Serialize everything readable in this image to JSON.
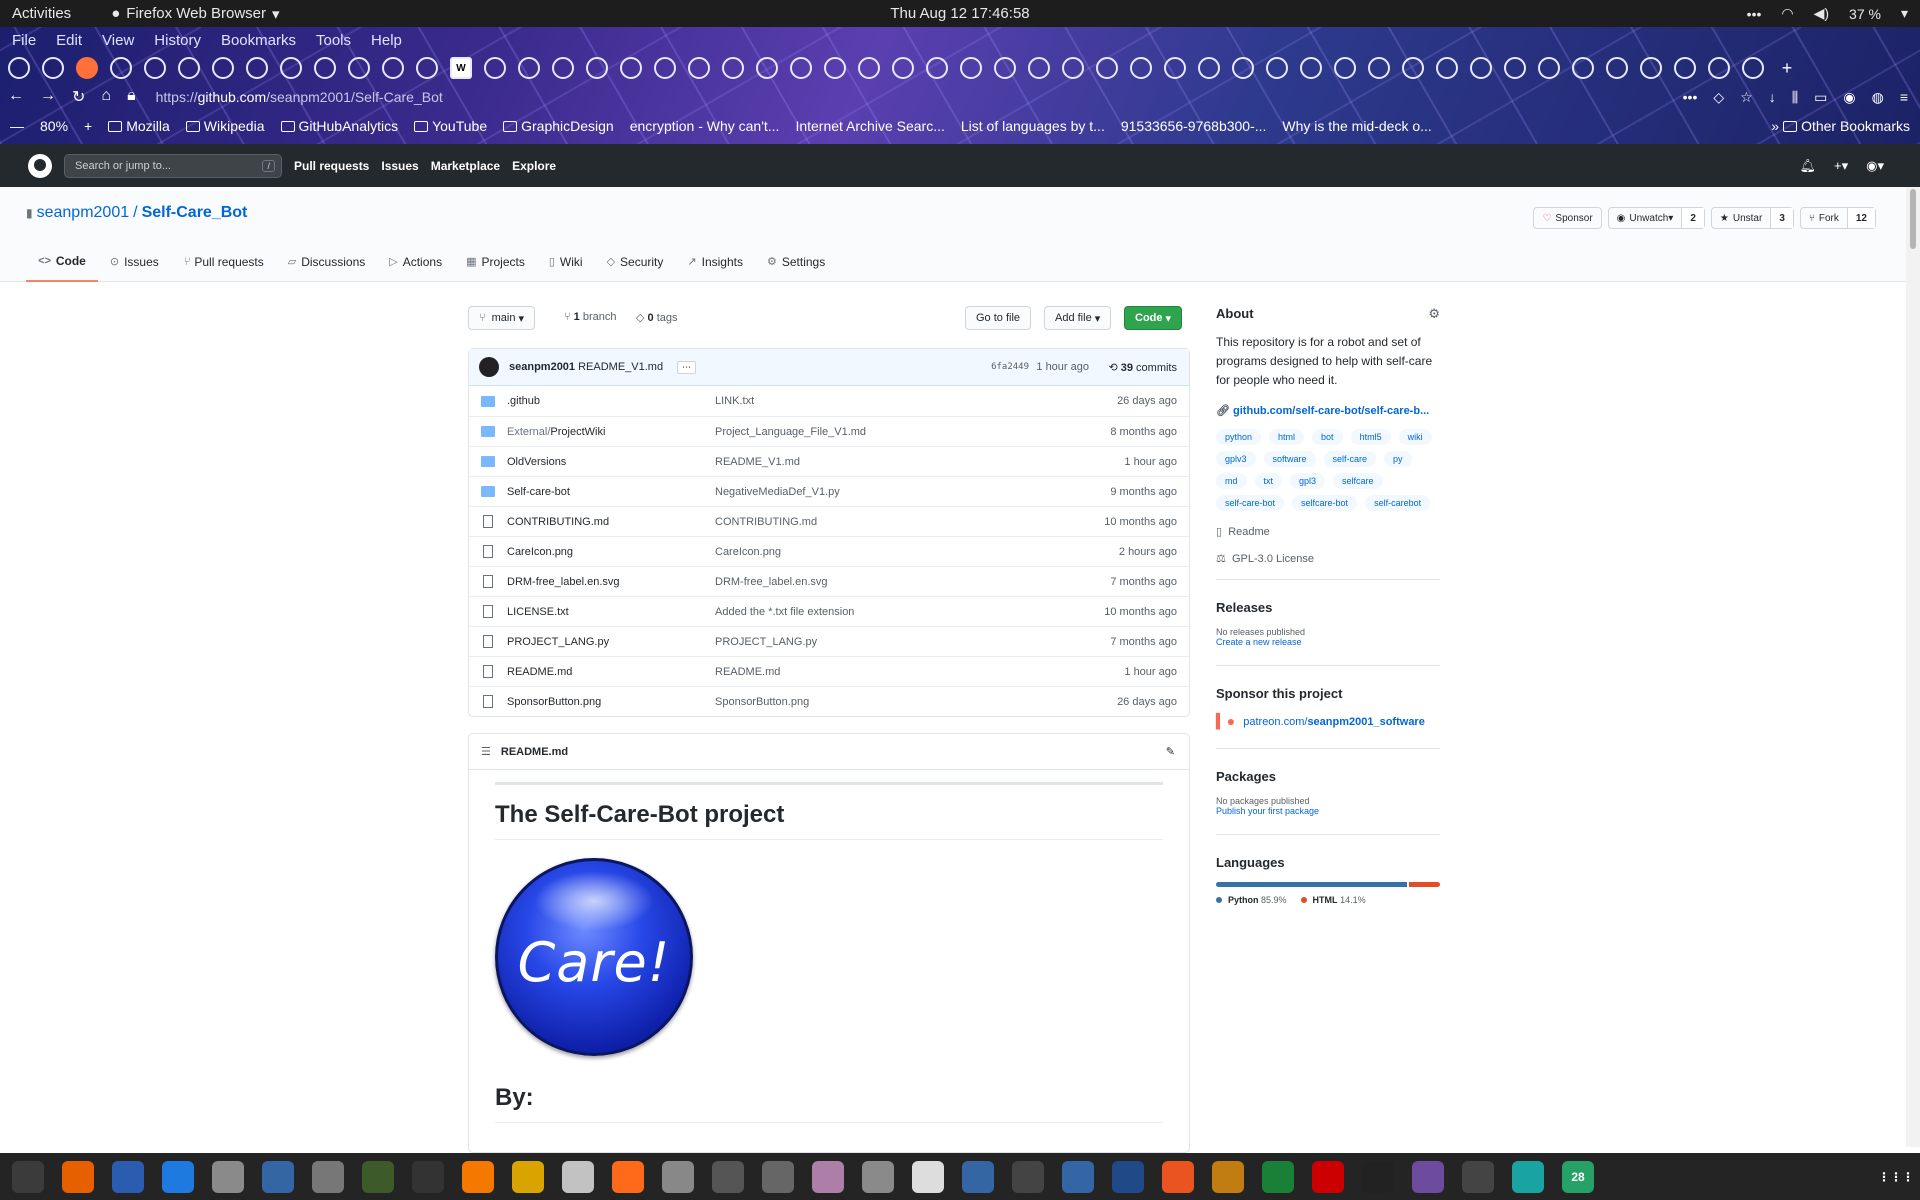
{
  "topbar": {
    "activities": "Activities",
    "app_name": "Firefox Web Browser",
    "clock": "Thu Aug 12  17:46:58",
    "battery": "37 %"
  },
  "menu": [
    "File",
    "Edit",
    "View",
    "History",
    "Bookmarks",
    "Tools",
    "Help"
  ],
  "urlbar": {
    "url_prefix": "https://",
    "url_host": "github.com",
    "url_path": "/seanpm2001/Self-Care_Bot",
    "zoom": "80%"
  },
  "bookmarks": [
    "Mozilla",
    "Wikipedia",
    "GitHubAnalytics",
    "YouTube",
    "GraphicDesign",
    "encryption - Why can't...",
    "Internet Archive Searc...",
    "List of languages by t...",
    "91533656-9768b300-...",
    "Why is the mid-deck o...",
    "Other Bookmarks"
  ],
  "gh": {
    "search_placeholder": "Search or jump to...",
    "search_key": "/",
    "nav": [
      "Pull requests",
      "Issues",
      "Marketplace",
      "Explore"
    ]
  },
  "repo": {
    "owner": "seanpm2001",
    "sep": "/",
    "name": "Self-Care_Bot",
    "sponsor": "Sponsor",
    "unwatch": "Unwatch",
    "watch_count": "2",
    "unstar": "Unstar",
    "star_count": "3",
    "fork": "Fork",
    "fork_count": "12",
    "tabs": [
      "Code",
      "Issues",
      "Pull requests",
      "Discussions",
      "Actions",
      "Projects",
      "Wiki",
      "Security",
      "Insights",
      "Settings"
    ]
  },
  "toolbar": {
    "branch": "main",
    "branches_n": "1",
    "branches_label": "branch",
    "tags_n": "0",
    "tags_label": "tags",
    "go_to_file": "Go to file",
    "add_file": "Add file",
    "code": "Code"
  },
  "commit": {
    "author": "seanpm2001",
    "message": "README_V1.md",
    "sha": "6fa2449",
    "when": "1 hour ago",
    "count": "39",
    "count_label": "commits"
  },
  "files": [
    {
      "type": "dir",
      "name_dim": "",
      "name": ".github",
      "msg": "LINK.txt",
      "ago": "26 days ago"
    },
    {
      "type": "dir",
      "name_dim": "External/",
      "name": "ProjectWiki",
      "msg": "Project_Language_File_V1.md",
      "ago": "8 months ago"
    },
    {
      "type": "dir",
      "name_dim": "",
      "name": "OldVersions",
      "msg": "README_V1.md",
      "ago": "1 hour ago"
    },
    {
      "type": "dir",
      "name_dim": "",
      "name": "Self-care-bot",
      "msg": "NegativeMediaDef_V1.py",
      "ago": "9 months ago"
    },
    {
      "type": "file",
      "name_dim": "",
      "name": "CONTRIBUTING.md",
      "msg": "CONTRIBUTING.md",
      "ago": "10 months ago"
    },
    {
      "type": "file",
      "name_dim": "",
      "name": "CareIcon.png",
      "msg": "CareIcon.png",
      "ago": "2 hours ago"
    },
    {
      "type": "file",
      "name_dim": "",
      "name": "DRM-free_label.en.svg",
      "msg": "DRM-free_label.en.svg",
      "ago": "7 months ago"
    },
    {
      "type": "file",
      "name_dim": "",
      "name": "LICENSE.txt",
      "msg": "Added the *.txt file extension",
      "ago": "10 months ago"
    },
    {
      "type": "file",
      "name_dim": "",
      "name": "PROJECT_LANG.py",
      "msg": "PROJECT_LANG.py",
      "ago": "7 months ago"
    },
    {
      "type": "file",
      "name_dim": "",
      "name": "README.md",
      "msg": "README.md",
      "ago": "1 hour ago"
    },
    {
      "type": "file",
      "name_dim": "",
      "name": "SponsorButton.png",
      "msg": "SponsorButton.png",
      "ago": "26 days ago"
    }
  ],
  "readme": {
    "file": "README.md",
    "h1": "The Self-Care-Bot project",
    "logo_text": "Care!",
    "h2": "By:"
  },
  "about": {
    "title": "About",
    "desc": "This repository is for a robot and set of programs designed to help with self-care for people who need it.",
    "link": "github.com/self-care-bot/self-care-b...",
    "topics": [
      "python",
      "html",
      "bot",
      "html5",
      "wiki",
      "gplv3",
      "software",
      "self-care",
      "py",
      "md",
      "txt",
      "gpl3",
      "selfcare",
      "self-care-bot",
      "selfcare-bot",
      "self-carebot"
    ],
    "readme": "Readme",
    "license": "GPL-3.0 License"
  },
  "releases": {
    "title": "Releases",
    "none": "No releases published",
    "create": "Create a new release"
  },
  "sponsor": {
    "title": "Sponsor this project",
    "link_prefix": "patreon.com/",
    "link_user": "seanpm2001_software"
  },
  "packages": {
    "title": "Packages",
    "none": "No packages published",
    "publish": "Publish your first package"
  },
  "languages": {
    "title": "Languages",
    "items": [
      {
        "name": "Python",
        "pct": "85.9%",
        "value": 85.9,
        "color": "#3572A5"
      },
      {
        "name": "HTML",
        "pct": "14.1%",
        "value": 14.1,
        "color": "#e34c26"
      }
    ]
  },
  "dock_badge": "28"
}
